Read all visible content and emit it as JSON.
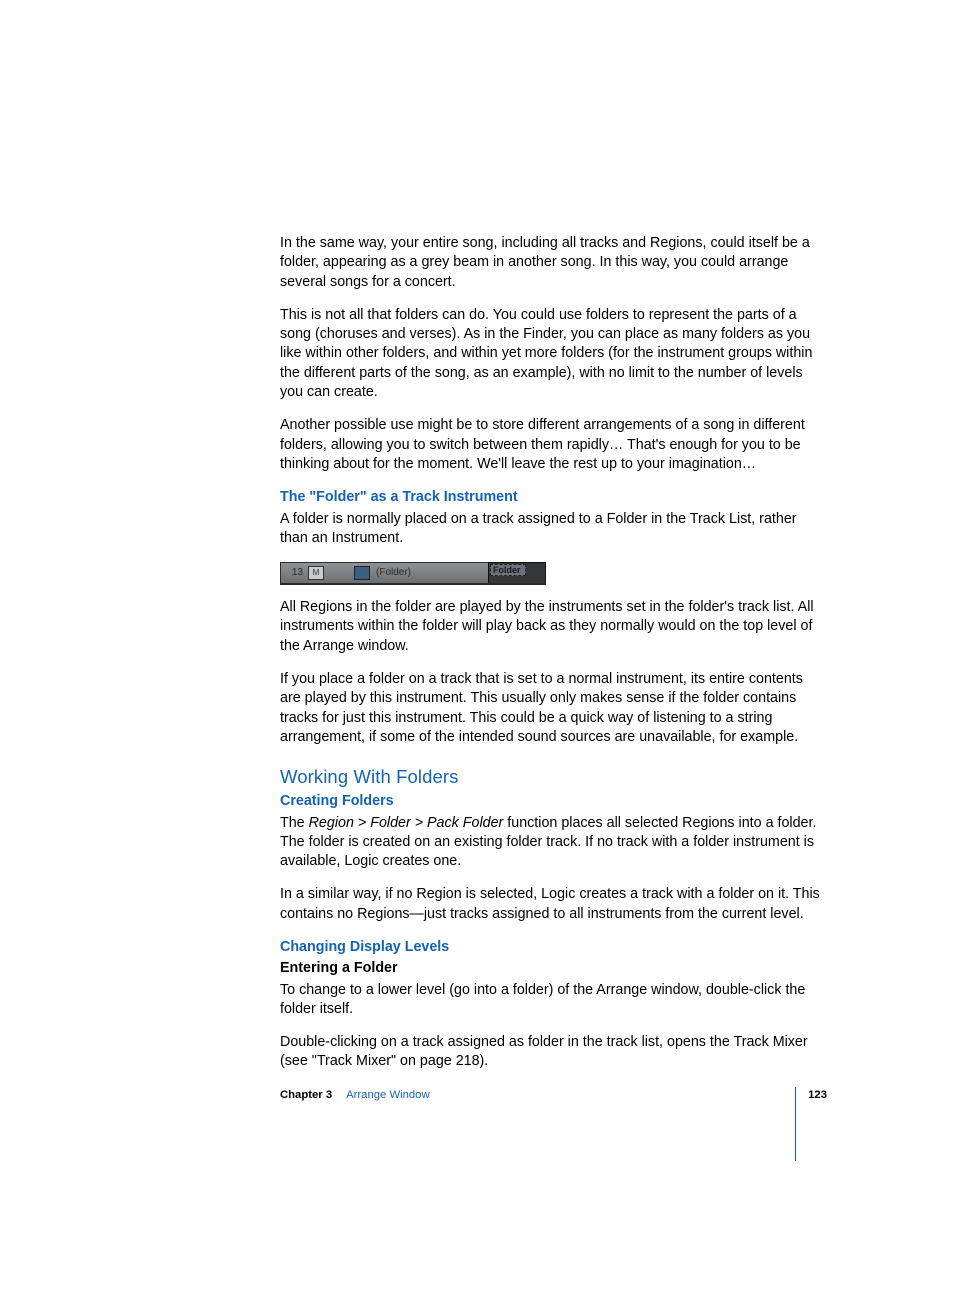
{
  "para1": "In the same way, your entire song, including all tracks and Regions, could itself be a folder, appearing as a grey beam in another song. In this way, you could arrange several songs for a concert.",
  "para2": "This is not all that folders can do. You could use folders to represent the parts of a song (choruses and verses). As in the Finder, you can place as many folders as you like within other folders, and within yet more folders (for the instrument groups within the different parts of the song, as an example), with no limit to the number of levels you can create.",
  "para3": "Another possible use might be to store different arrangements of a song in different folders, allowing you to switch between them rapidly… That's enough for you to be thinking about for the moment. We'll leave the rest up to your imagination…",
  "h_folder_instr": "The \"Folder\" as a Track Instrument",
  "para4": "A folder is normally placed on a track assigned to a Folder in the Track List, rather than an Instrument.",
  "fig": {
    "num": "13",
    "mute": "M",
    "label": "(Folder)",
    "region": "Folder"
  },
  "para5": "All Regions in the folder are played by the instruments set in the folder's track list. All instruments within the folder will play back as they normally would on the top level of the Arrange window.",
  "para6": "If you place a folder on a track that is set to a normal instrument, its entire contents are played by this instrument. This usually only makes sense if the folder contains tracks for just this instrument. This could be a quick way of listening to a string arrangement, if some of the intended sound sources are unavailable, for example.",
  "h_working": "Working With Folders",
  "h_creating": "Creating Folders",
  "para7a": "The ",
  "para7i": "Region > Folder > Pack Folder",
  "para7b": " function places all selected Regions into a folder. The folder is created on an existing folder track. If no track with a folder instrument is available, Logic creates one.",
  "para8": "In a similar way, if no Region is selected, Logic creates a track with a folder on it. This contains no Regions—just tracks assigned to all instruments from the current level.",
  "h_changing": "Changing Display Levels",
  "h_entering": "Entering a Folder",
  "para9": "To change to a lower level (go into a folder) of the Arrange window, double-click the folder itself.",
  "para10": "Double-clicking on a track assigned as folder in the track list, opens the Track Mixer (see \"Track Mixer\" on page 218).",
  "footer": {
    "chapter": "Chapter 3",
    "name": "Arrange Window",
    "page": "123"
  }
}
